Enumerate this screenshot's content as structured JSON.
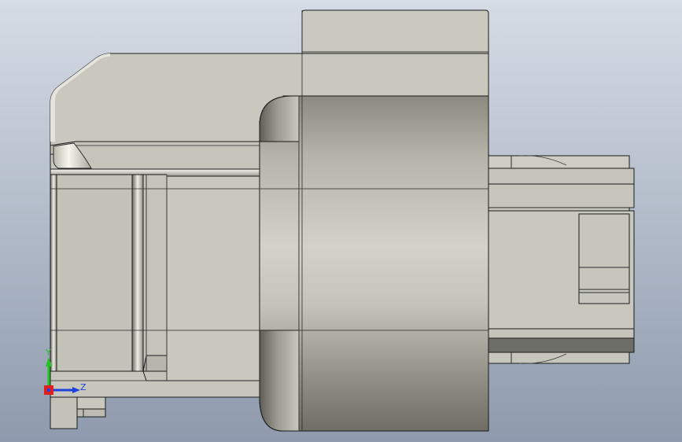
{
  "viewport": {
    "background_top": "#d3d9e3",
    "background_bottom": "#8f9bae"
  },
  "model": {
    "face_color": "#c6c6bd",
    "edge_color": "#1a1a1a",
    "shade_color": "#7a7a70",
    "highlight_color": "#f2f2ea"
  },
  "triad": {
    "y_label": "Y",
    "z_label": "Z",
    "y_color": "#22c322",
    "z_color": "#1f3fe0",
    "x_color": "#e02020"
  }
}
